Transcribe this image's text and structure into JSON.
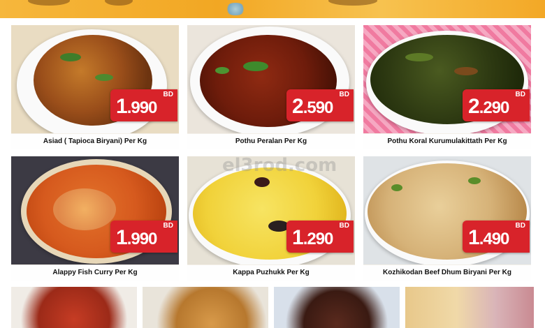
{
  "currency": "BD",
  "watermark": "el3rod.com",
  "products": [
    {
      "name": "Asiad ( Tapioca Biryani) Per Kg",
      "whole": "1",
      "decimal": ".990"
    },
    {
      "name": "Pothu Peralan Per Kg",
      "whole": "2",
      "decimal": ".590"
    },
    {
      "name": "Pothu Koral Kurumulakittath Per Kg",
      "whole": "2",
      "decimal": ".290"
    },
    {
      "name": "Alappy Fish Curry Per Kg",
      "whole": "1",
      "decimal": ".990"
    },
    {
      "name": "Kappa Puzhukk Per Kg",
      "whole": "1",
      "decimal": ".290"
    },
    {
      "name": "Kozhikodan Beef Dhum Biryani Per Kg",
      "whole": "1",
      "decimal": ".490"
    }
  ],
  "colors": {
    "price_tag": "#d8232a",
    "banner": "#f2a723",
    "caption_bg": "#ffffff"
  }
}
